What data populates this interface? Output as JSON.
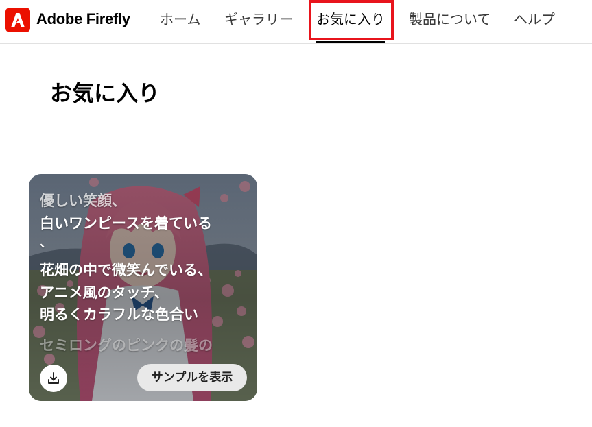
{
  "brand": {
    "name": "Adobe Firefly",
    "logo_icon": "adobe-logo-icon",
    "logo_color": "#eb1000"
  },
  "nav": {
    "items": [
      {
        "label": "ホーム"
      },
      {
        "label": "ギャラリー"
      },
      {
        "label": "お気に入り",
        "active": true
      },
      {
        "label": "製品について"
      },
      {
        "label": "ヘルプ"
      }
    ],
    "highlight_color": "#e8141c"
  },
  "page": {
    "title": "お気に入り"
  },
  "card": {
    "prompt_lines": [
      "優しい笑顔、",
      "白いワンピースを着ている",
      "、",
      "花畑の中で微笑んでいる、",
      "アニメ風のタッチ、",
      "明るくカラフルな色合い",
      "セミロングのピンクの髪の"
    ],
    "download_icon": "download-icon",
    "sample_button_label": "サンプルを表示"
  }
}
